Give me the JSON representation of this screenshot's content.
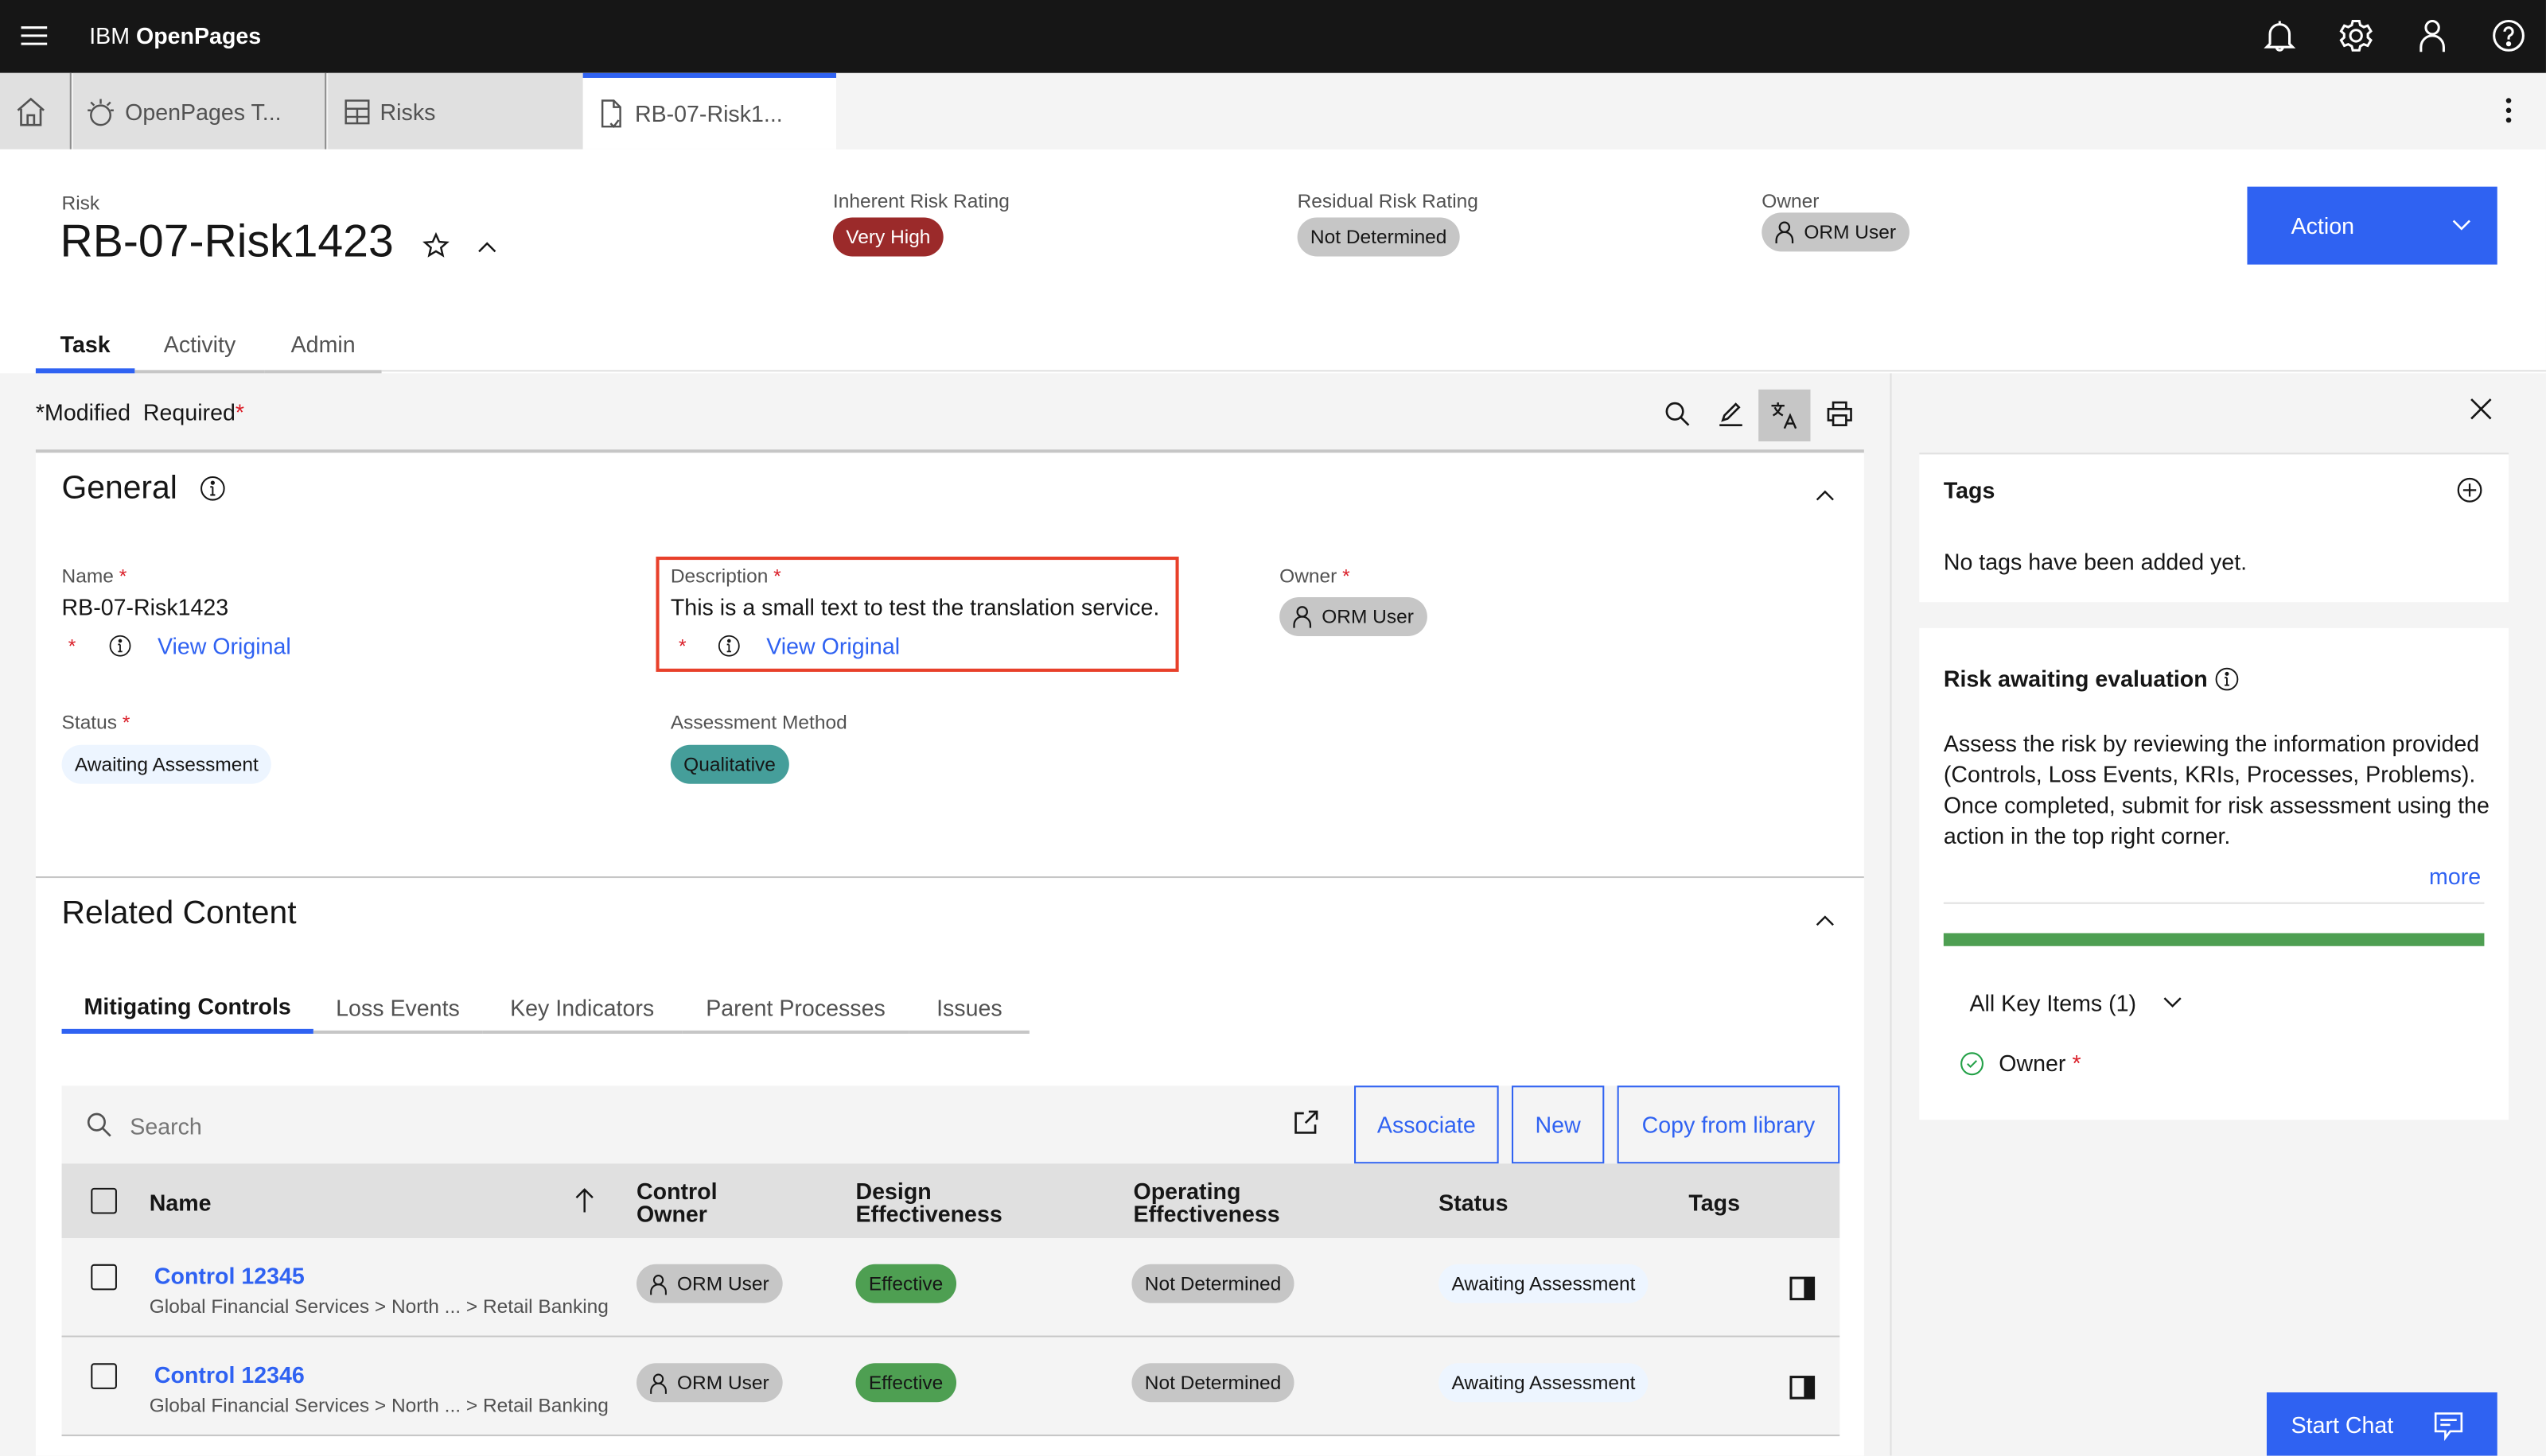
{
  "topbar": {
    "brand_prefix": "IBM",
    "brand_name": "OpenPages",
    "icons": [
      "menu-icon",
      "notification-icon",
      "settings-icon",
      "user-icon",
      "help-icon"
    ]
  },
  "tabs": [
    {
      "label": "OpenPages T...",
      "icon": "watson-icon"
    },
    {
      "label": "Risks",
      "icon": "table-icon"
    },
    {
      "label": "RB-07-Risk1...",
      "icon": "document-icon",
      "active": true
    }
  ],
  "header": {
    "object_type": "Risk",
    "title": "RB-07-Risk1423",
    "inherent_label": "Inherent Risk Rating",
    "inherent_value": "Very High",
    "residual_label": "Residual Risk Rating",
    "residual_value": "Not Determined",
    "owner_label": "Owner",
    "owner_value": "ORM User",
    "action_label": "Action",
    "tabs": [
      "Task",
      "Activity",
      "Admin"
    ],
    "active_tab": "Task"
  },
  "toolbar": {
    "modified_marker": "*",
    "modified_label": "Modified",
    "required_label": "Required",
    "required_marker": "*"
  },
  "general": {
    "title": "General",
    "name_label": "Name",
    "name_value": "RB-07-Risk1423",
    "view_original": "View Original",
    "description_label": "Description",
    "description_value": "This is a small text to test the translation service.",
    "owner_label": "Owner",
    "owner_value": "ORM User",
    "status_label": "Status",
    "status_value": "Awaiting Assessment",
    "assessment_label": "Assessment Method",
    "assessment_value": "Qualitative",
    "required_marker": "*"
  },
  "related": {
    "title": "Related Content",
    "tabs": [
      "Mitigating Controls",
      "Loss Events",
      "Key Indicators",
      "Parent Processes",
      "Issues"
    ],
    "active_tab": "Mitigating Controls",
    "search_placeholder": "Search",
    "buttons": {
      "associate": "Associate",
      "new": "New",
      "copy": "Copy from library"
    },
    "columns": [
      "Name",
      "Control Owner",
      "Design Effectiveness",
      "Operating Effectiveness",
      "Status",
      "Tags"
    ],
    "column_lines": {
      "control_owner": [
        "Control",
        "Owner"
      ],
      "design": [
        "Design",
        "Effectiveness"
      ],
      "operating": [
        "Operating",
        "Effectiveness"
      ]
    },
    "rows": [
      {
        "name": "Control 12345",
        "path": "Global Financial Services > North ... > Retail Banking",
        "owner": "ORM User",
        "design": "Effective",
        "operating": "Not Determined",
        "status": "Awaiting Assessment"
      },
      {
        "name": "Control 12346",
        "path": "Global Financial Services > North ... > Retail Banking",
        "owner": "ORM User",
        "design": "Effective",
        "operating": "Not Determined",
        "status": "Awaiting Assessment"
      }
    ]
  },
  "side": {
    "tags_title": "Tags",
    "tags_empty": "No tags have been added yet.",
    "eval_title": "Risk awaiting evaluation",
    "eval_text": "Assess the risk by reviewing the information provided (Controls, Loss Events, KRIs, Processes, Problems). Once completed, submit for risk assessment using the action in the top right corner.",
    "more_label": "more",
    "progress_percent": 100,
    "key_items_label": "All Key Items (1)",
    "key_items": [
      {
        "label": "Owner",
        "required": "*",
        "complete": true
      }
    ]
  },
  "chat": {
    "label": "Start Chat"
  },
  "colors": {
    "accent": "#2f62f2",
    "danger": "#9b2a2a",
    "success": "#4e9f52",
    "teal": "#459e9a",
    "highlight_border": "#e8402a"
  }
}
